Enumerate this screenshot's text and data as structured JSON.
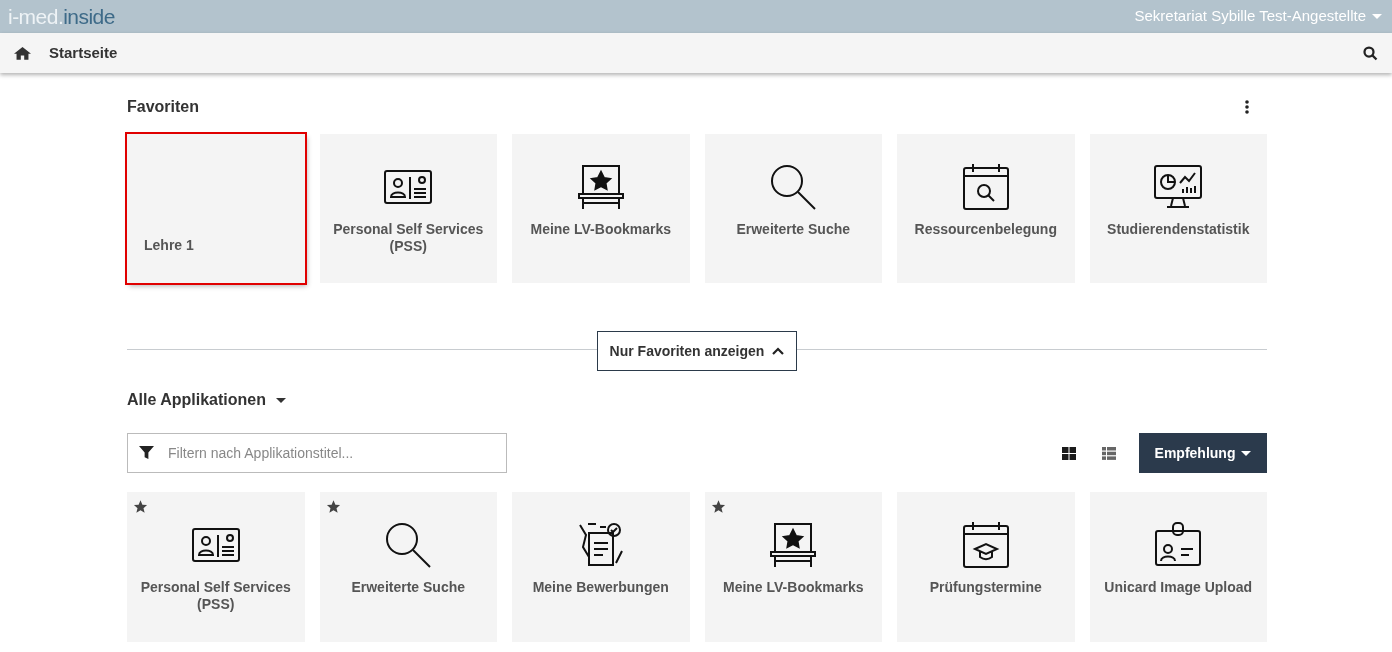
{
  "header": {
    "logo_part_1": "i-med.",
    "logo_part_2": "inside",
    "user": "Sekretariat Sybille Test-Angestellte"
  },
  "nav": {
    "title": "Startseite"
  },
  "favorites": {
    "title": "Favoriten",
    "tiles": [
      {
        "kind": "folder",
        "label": "Lehre 1",
        "highlighted": true
      },
      {
        "kind": "id-card",
        "label": "Personal Self Services (PSS)",
        "highlighted": false
      },
      {
        "kind": "bookmark",
        "label": "Meine LV-Bookmarks",
        "highlighted": false
      },
      {
        "kind": "search",
        "label": "Erweiterte Suche",
        "highlighted": false
      },
      {
        "kind": "calendar-search",
        "label": "Ressourcenbelegung",
        "highlighted": false
      },
      {
        "kind": "monitor-chart",
        "label": "Studierendenstatistik",
        "highlighted": false
      }
    ]
  },
  "toggle_button": {
    "label": "Nur Favoriten anzeigen",
    "expanded": true
  },
  "all_apps": {
    "title": "Alle Applikationen",
    "filter": {
      "placeholder": "Filtern nach Applikationstitel..."
    },
    "view_buttons": [
      {
        "kind": "grid",
        "selected": true
      },
      {
        "kind": "list",
        "selected": false
      }
    ],
    "sort_button": "Empfehlung",
    "tiles": [
      {
        "kind": "id-card",
        "label": "Personal Self Services (PSS)",
        "favorite": true
      },
      {
        "kind": "search",
        "label": "Erweiterte Suche",
        "favorite": true
      },
      {
        "kind": "application",
        "label": "Meine Bewerbungen",
        "favorite": false
      },
      {
        "kind": "bookmark",
        "label": "Meine LV-Bookmarks",
        "favorite": true
      },
      {
        "kind": "calendar-cap",
        "label": "Prüfungstermine",
        "favorite": false
      },
      {
        "kind": "badge",
        "label": "Unicard Image Upload",
        "favorite": false
      }
    ]
  }
}
